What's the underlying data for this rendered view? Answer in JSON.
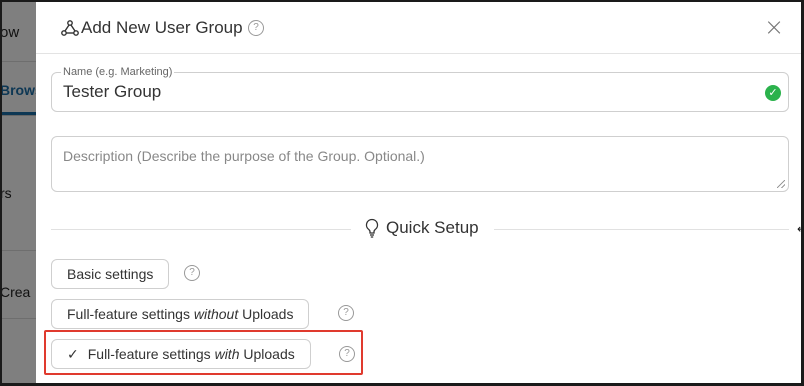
{
  "background": {
    "topbar_text": "ow",
    "active_tab": "Brows",
    "side_items": [
      "rs",
      "Crea"
    ]
  },
  "modal": {
    "title": "Add New User Group",
    "title_icon": "user-group-icon",
    "close_label": "×",
    "name_field": {
      "legend": "Name (e.g. Marketing)",
      "value": "Tester Group",
      "status_icon": "check-circle-icon",
      "status_color": "#2bb24c"
    },
    "description_field": {
      "placeholder": "Description (Describe the purpose of the Group. Optional.)",
      "value": ""
    },
    "quick_setup": {
      "heading": "Quick Setup",
      "icon": "lightbulb-icon",
      "presets": [
        {
          "label": "Basic settings",
          "selected": false
        },
        {
          "label_pre": "Full-feature settings ",
          "label_em": "without",
          "label_post": " Uploads",
          "selected": false
        },
        {
          "label_pre": "Full-feature settings ",
          "label_em": "with",
          "label_post": " Uploads",
          "selected": true,
          "check": "✓"
        }
      ]
    },
    "help_glyph": "?"
  },
  "colors": {
    "accent_tab": "#1b6ea8",
    "highlight": "#e03a2e",
    "success": "#2bb24c"
  }
}
